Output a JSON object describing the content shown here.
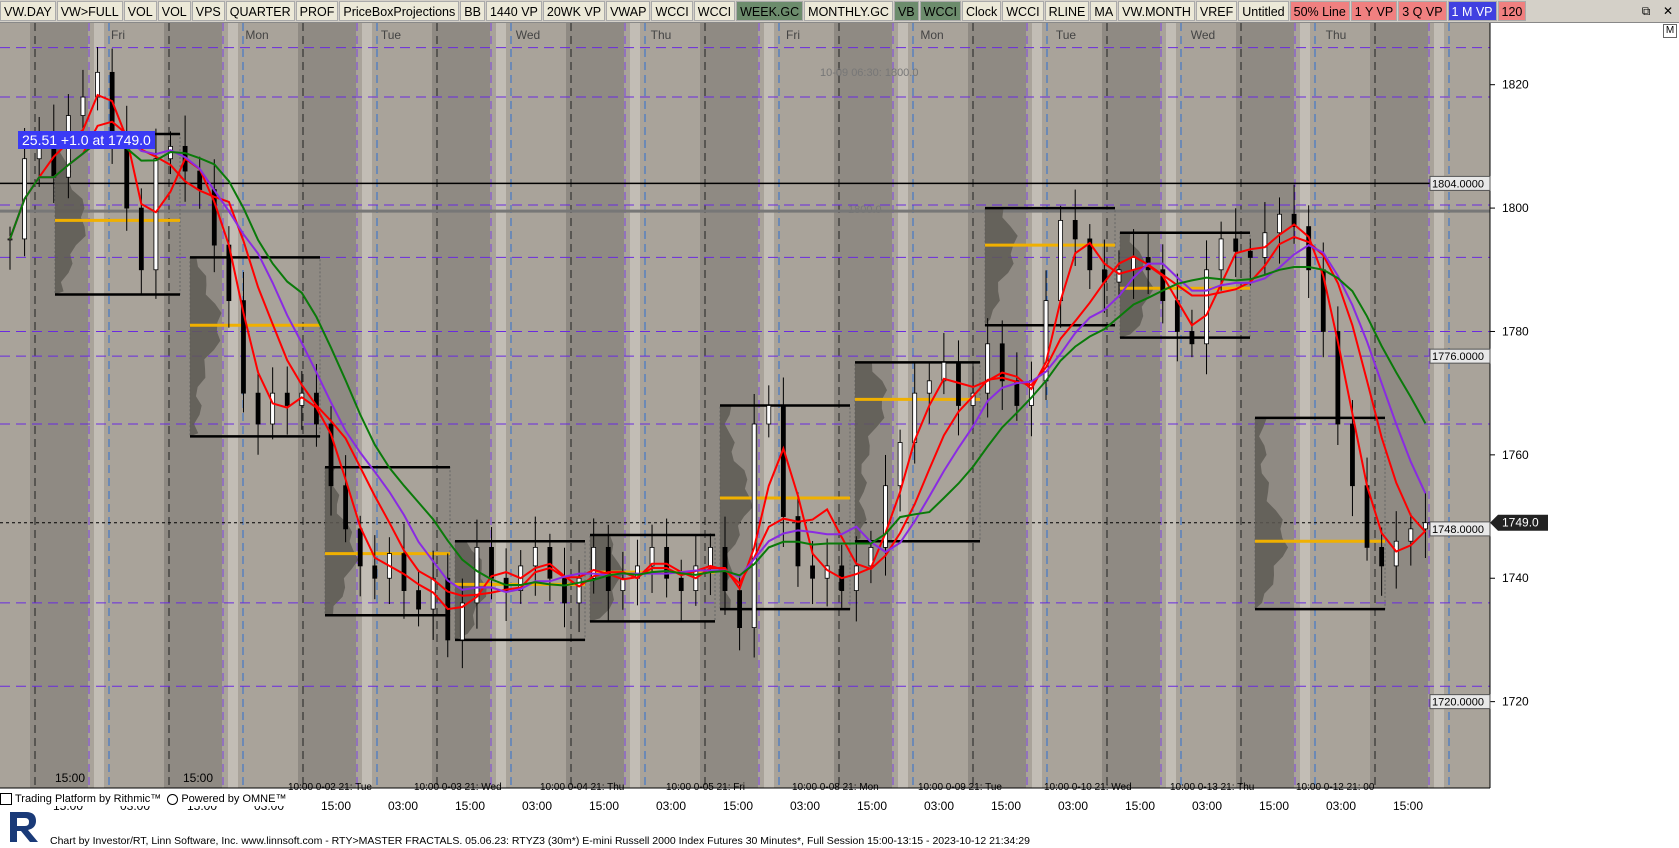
{
  "toolbar": {
    "buttons": [
      {
        "label": "VW.DAY",
        "color": "#ece9d8"
      },
      {
        "label": "VW>FULL",
        "color": "#ece9d8"
      },
      {
        "label": "VOL",
        "color": "#ece9d8"
      },
      {
        "label": "VOL",
        "color": "#ece9d8"
      },
      {
        "label": "VPS",
        "color": "#ece9d8"
      },
      {
        "label": "QUARTER",
        "color": "#ece9d8"
      },
      {
        "label": "PROF",
        "color": "#ece9d8"
      },
      {
        "label": "PriceBoxProjections",
        "color": "#ece9d8"
      },
      {
        "label": "BB",
        "color": "#ece9d8"
      },
      {
        "label": "1440 VP",
        "color": "#ece9d8"
      },
      {
        "label": "20WK VP",
        "color": "#ece9d8"
      },
      {
        "label": "VWAP",
        "color": "#ece9d8"
      },
      {
        "label": "WCCI",
        "color": "#ece9d8"
      },
      {
        "label": "WCCI",
        "color": "#ece9d8"
      },
      {
        "label": "WEEK.GC",
        "color": "#6c8c6c"
      },
      {
        "label": "MONTHLY.GC",
        "color": "#ece9d8"
      },
      {
        "label": "VB",
        "color": "#6c8c6c"
      },
      {
        "label": "WCCI",
        "color": "#6c8c6c"
      },
      {
        "label": "Clock",
        "color": "#ece9d8"
      },
      {
        "label": "WCCI",
        "color": "#ece9d8"
      },
      {
        "label": "RLINE",
        "color": "#ece9d8"
      },
      {
        "label": "MA",
        "color": "#ece9d8"
      },
      {
        "label": "VW.MONTH",
        "color": "#ece9d8"
      },
      {
        "label": "VREF",
        "color": "#ece9d8"
      },
      {
        "label": "Untitled",
        "color": "#ece9d8"
      },
      {
        "label": "50% Line",
        "color": "#f08080"
      },
      {
        "label": "1 Y VP",
        "color": "#f08080"
      },
      {
        "label": "3 Q VP",
        "color": "#f08080"
      },
      {
        "label": "1 M VP",
        "color": "#4040e0"
      },
      {
        "label": "120",
        "color": "#f08080"
      }
    ],
    "restore_icon": "restore-icon",
    "close_icon": "close-icon",
    "m_label": "M"
  },
  "day_labels": [
    {
      "label": "Fri",
      "x": 118
    },
    {
      "label": "Mon",
      "x": 257
    },
    {
      "label": "Tue",
      "x": 391
    },
    {
      "label": "Wed",
      "x": 528
    },
    {
      "label": "Thu",
      "x": 661
    },
    {
      "label": "Fri",
      "x": 793
    },
    {
      "label": "Mon",
      "x": 932
    },
    {
      "label": "Tue",
      "x": 1066
    },
    {
      "label": "Wed",
      "x": 1203
    },
    {
      "label": "Thu",
      "x": 1336
    }
  ],
  "chart_data": {
    "type": "candlestick",
    "title": "05.06.23: RTYZ3 (30m*) E-mini Russell 2000 Index Futures 30 Minutes*, Full Session 15:00-13:15",
    "ylim": [
      1706,
      1830
    ],
    "y_ticks": [
      1720,
      1740,
      1760,
      1780,
      1800,
      1820
    ],
    "x_tick_labels": [
      "15:00",
      "03:00",
      "15:00",
      "03:00",
      "15:00",
      "03:00",
      "15:00",
      "03:00",
      "15:00",
      "03:00",
      "15:00",
      "03:00",
      "15:00",
      "03:00",
      "15:00",
      "03:00",
      "15:00",
      "03:00",
      "15:00",
      "03:00",
      "15:00"
    ],
    "price_line_labels": [
      {
        "value": 1804.0,
        "label": "1804.0000"
      },
      {
        "value": 1776.0,
        "label": "1776.0000"
      },
      {
        "value": 1748.0,
        "label": "1748.0000"
      },
      {
        "value": 1720.0,
        "label": "1720.0000"
      }
    ],
    "last_price": {
      "value": 1749.0,
      "label": "1749.0"
    },
    "annotations": [
      {
        "text": "10-09 06:30: 1800.0"
      },
      {
        "text": "1800.0"
      },
      {
        "text": "25.51  +1.0 at 1749.0"
      }
    ],
    "session_labels": [
      "10:00 0-02 21: Tue",
      "10:00 0-03 21: Wed",
      "10:00 0-04 21: Thu",
      "10:00 0-05 21: Fri",
      "10:00 0-08 21: Mon",
      "10:00 0-09 21: Tue",
      "10:00 0-10 21: Wed",
      "10:00 0-13 21: Thu",
      "10:00 0-12 21: 00"
    ],
    "close_series": [
      1795,
      1808,
      1812,
      1805,
      1815,
      1818,
      1822,
      1812,
      1800,
      1790,
      1808,
      1810,
      1806,
      1803,
      1794,
      1785,
      1770,
      1765,
      1770,
      1768,
      1770,
      1765,
      1755,
      1748,
      1742,
      1740,
      1744,
      1738,
      1735,
      1740,
      1730,
      1736,
      1745,
      1740,
      1738,
      1742,
      1745,
      1740,
      1736,
      1740,
      1745,
      1738,
      1740,
      1742,
      1745,
      1740,
      1738,
      1742,
      1745,
      1738,
      1732,
      1765,
      1768,
      1750,
      1742,
      1740,
      1742,
      1738,
      1742,
      1745,
      1755,
      1762,
      1770,
      1772,
      1775,
      1768,
      1770,
      1778,
      1772,
      1768,
      1772,
      1785,
      1798,
      1795,
      1790,
      1788,
      1790,
      1792,
      1790,
      1785,
      1780,
      1778,
      1790,
      1795,
      1793,
      1792,
      1796,
      1799,
      1797,
      1790,
      1780,
      1765,
      1755,
      1745,
      1742,
      1746,
      1748,
      1749
    ]
  },
  "brand": {
    "rithmic": "Trading Platform by Rithmic™",
    "omne": "Powered by OMNE™"
  },
  "footer": "Chart by Investor/RT, Linn Software, Inc. www.linnsoft.com - RTY>MASTER FRACTALS.   05.06.23: RTYZ3 (30m*) E-mini Russell 2000 Index Futures 30 Minutes*, Full Session 15:00-13:15 - 2023-10-12 21:34:29"
}
